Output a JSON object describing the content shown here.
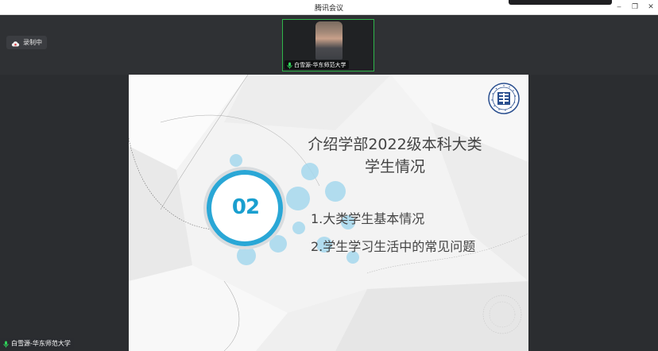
{
  "window": {
    "title": "腾讯会议",
    "minimize_glyph": "‒",
    "restore_glyph": "❐",
    "close_glyph": "✕"
  },
  "recording": {
    "label": "录制中",
    "icon": "cloud-icon"
  },
  "speaker": {
    "name": "白雪源-华东师范大学",
    "mic_icon": "microphone-icon",
    "active_color": "#2fb54a"
  },
  "slide": {
    "heading_line1": "介绍学部2022级本科大类",
    "heading_line2": "学生情况",
    "section_number": "02",
    "items": [
      "1.大类学生基本情况",
      "2.学生学习生活中的常见问题"
    ],
    "accent_color": "#1a9fcf",
    "bubble_color": "#9fd3ea"
  },
  "self_view": {
    "name": "白雪源-华东师范大学",
    "mic_icon": "microphone-icon"
  }
}
